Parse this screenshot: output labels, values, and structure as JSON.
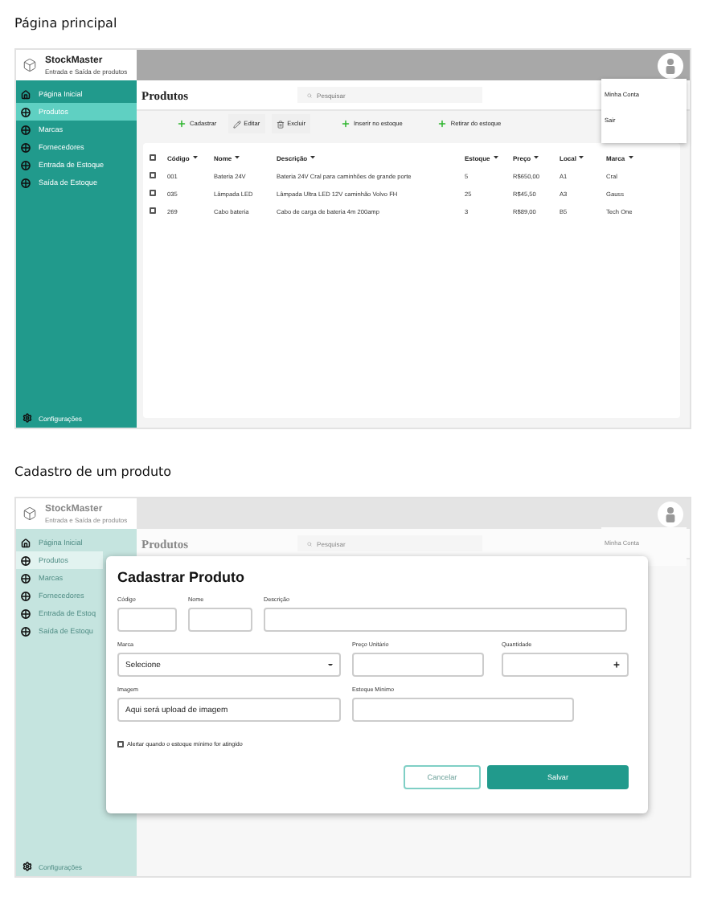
{
  "main_page": {
    "heading": "Página principal",
    "app": {
      "logo": {
        "title": "StockMaster",
        "subtitle": "Entrada e Saída de produtos"
      },
      "sidebar": {
        "items": [
          {
            "label": "Página Inicial",
            "kind": "home",
            "selected": false
          },
          {
            "label": "Produtos",
            "kind": "module",
            "selected": true
          },
          {
            "label": "Marcas",
            "kind": "module",
            "selected": false
          },
          {
            "label": "Fornecedores",
            "kind": "module",
            "selected": false
          },
          {
            "label": "Entrada de Estoque",
            "kind": "module",
            "selected": false
          },
          {
            "label": "Saída de Estoque",
            "kind": "module",
            "selected": false
          }
        ],
        "footer": "Configurações"
      },
      "page_title": "Produtos",
      "search": {
        "placeholder": "Pesquisar"
      },
      "toolbar": [
        {
          "label": "Cadastrar",
          "kind": "add"
        },
        {
          "label": "Editar",
          "kind": "edit"
        },
        {
          "label": "Excluir",
          "kind": "delete"
        },
        {
          "label": "Inserir no estoque",
          "kind": "add"
        },
        {
          "label": "Retirar do estoque",
          "kind": "add"
        }
      ],
      "table": {
        "all_checked": false,
        "columns": [
          "Código",
          "Nome",
          "Descrição",
          "Estoque",
          "Preço",
          "Local",
          "Marca"
        ],
        "rows": [
          {
            "checked": false,
            "cells": [
              "001",
              "Bateria 24V",
              "Bateria 24V Cral para caminhões de grande porte",
              "5",
              "R$650,00",
              "A1",
              "Cral"
            ]
          },
          {
            "checked": false,
            "cells": [
              "035",
              "Lâmpada LED",
              "Lâmpada Ultra LED 12V caminhão Volvo FH",
              "25",
              "R$45,50",
              "A3",
              "Gauss"
            ]
          },
          {
            "checked": false,
            "cells": [
              "269",
              "Cabo bateria",
              "Cabo de carga de bateria 4m 200amp",
              "3",
              "R$89,00",
              "B5",
              "Tech One"
            ]
          }
        ]
      },
      "account_menu": [
        "Minha Conta",
        "Sair"
      ]
    }
  },
  "product_form": {
    "heading": "Cadastro de um produto",
    "background": {
      "logo": {
        "title": "StockMaster",
        "subtitle": "Entrada e Saída de produtos"
      },
      "sidebar": {
        "items": [
          {
            "label": "Página Inicial",
            "kind": "home",
            "selected": false
          },
          {
            "label": "Produtos",
            "kind": "module",
            "selected": true
          },
          {
            "label": "Marcas",
            "kind": "module",
            "selected": false
          },
          {
            "label": "Fornecedores",
            "kind": "module",
            "selected": false
          },
          {
            "label": "Entrada de Estoq",
            "kind": "module",
            "selected": false
          },
          {
            "label": "Saída de Estoqu",
            "kind": "module",
            "selected": false
          }
        ],
        "footer": "Configurações"
      },
      "page_title": "Produtos",
      "search": {
        "placeholder": "Pesquisar"
      },
      "account_menu": [
        "Minha Conta"
      ]
    },
    "dialog": {
      "title": "Cadastrar Produto",
      "rows": [
        [
          {
            "label": "Código",
            "kind": "text"
          },
          {
            "label": "Nome",
            "kind": "text"
          },
          {
            "label": "Descrição",
            "kind": "text"
          }
        ],
        [
          {
            "label": "Marca",
            "kind": "select",
            "value": "Selecione"
          },
          {
            "label": "Preço Unitário",
            "kind": "text"
          },
          {
            "label": "Quantidade",
            "kind": "stepper"
          }
        ],
        [
          {
            "label": "Imagem",
            "kind": "upload",
            "value": "Aqui será upload de imagem"
          },
          {
            "label": "Estoque Mínimo",
            "kind": "text"
          }
        ]
      ],
      "alert": {
        "label": "Alertar quando o estoque mínimo for atingido",
        "checked": false
      },
      "buttons": [
        {
          "label": "Cancelar",
          "kind": "secondary"
        },
        {
          "label": "Salvar",
          "kind": "primary"
        }
      ]
    }
  }
}
